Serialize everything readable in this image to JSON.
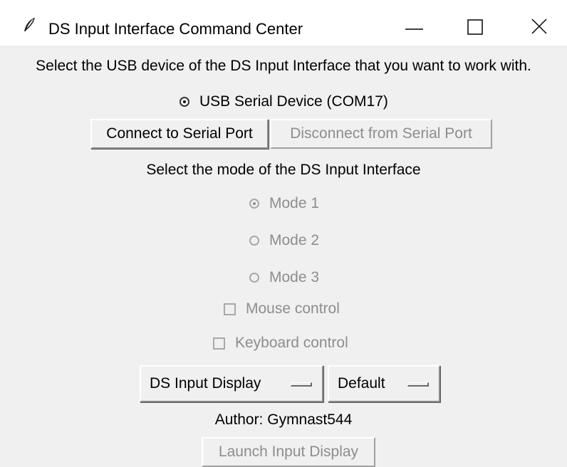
{
  "window": {
    "title": "DS Input Interface Command Center",
    "app_icon": "feather-icon",
    "controls": [
      "minimize-icon",
      "maximize-icon",
      "close-icon"
    ]
  },
  "device_section": {
    "prompt": "Select the USB device of the DS Input Interface that you want to work with.",
    "device_option": "USB Serial Device (COM17)",
    "connect_label": "Connect to Serial Port",
    "disconnect_label": "Disconnect from Serial Port"
  },
  "mode_section": {
    "prompt": "Select the mode of the DS Input Interface",
    "modes": [
      "Mode 1",
      "Mode 2",
      "Mode 3"
    ],
    "selected_mode": "Mode 1",
    "mouse_control_label": "Mouse control",
    "keyboard_control_label": "Keyboard control"
  },
  "display_section": {
    "display_menu_value": "DS Input Display",
    "profile_menu_value": "Default",
    "author": "Author: Gymnast544",
    "launch_label": "Launch Input Display"
  }
}
